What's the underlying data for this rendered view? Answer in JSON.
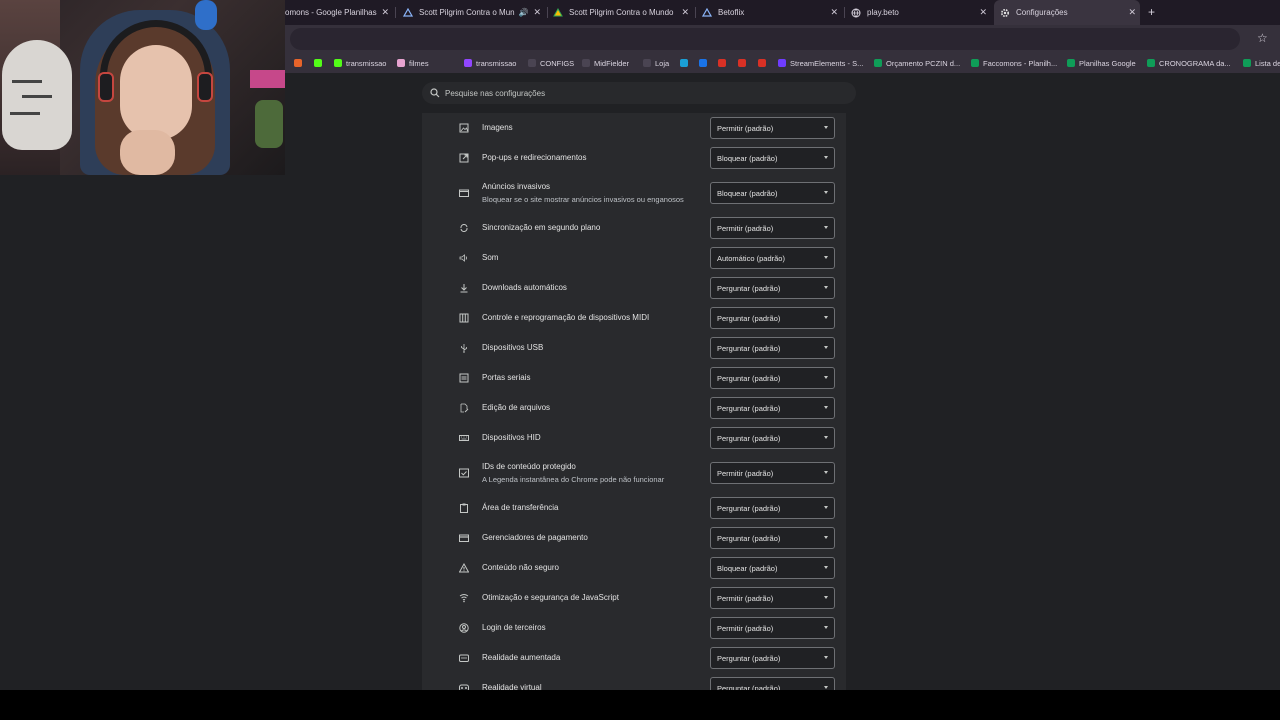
{
  "tabs": [
    {
      "label": "omons - Google Planilhas",
      "icon": "sheets-icon",
      "active": false
    },
    {
      "label": "Scott Pilgrim Contra o Mun",
      "icon": "drive-icon",
      "muted_icon": "speaker-icon",
      "active": false
    },
    {
      "label": "Scott Pilgrim Contra o Mundo",
      "icon": "drive-icon",
      "active": false
    },
    {
      "label": "Betoflix",
      "icon": "drive-icon",
      "active": false
    },
    {
      "label": "play.beto",
      "icon": "globe-icon",
      "active": false
    },
    {
      "label": "Configurações",
      "icon": "gear-icon",
      "active": true
    }
  ],
  "new_tab_label": "+",
  "bookmarks": [
    {
      "label": "",
      "color": "#e8642a"
    },
    {
      "label": "",
      "color": "#53fc18"
    },
    {
      "label": "transmissao",
      "color": "#53fc18"
    },
    {
      "label": "filmes",
      "color": "#e7a3d0"
    },
    {
      "label": "transmissao",
      "color": "#9146ff"
    },
    {
      "label": "CONFIGS",
      "color": "#4a4452"
    },
    {
      "label": "MidFielder",
      "color": "#4a4452"
    },
    {
      "label": "Loja",
      "color": "#4a4452"
    },
    {
      "label": "",
      "color": "#1a9fd6"
    },
    {
      "label": "",
      "color": "#1a73e8"
    },
    {
      "label": "",
      "color": "#d93025"
    },
    {
      "label": "",
      "color": "#d93025"
    },
    {
      "label": "",
      "color": "#d93025"
    },
    {
      "label": "StreamElements - S...",
      "color": "#6f3cff"
    },
    {
      "label": "Orçamento PCZIN d...",
      "color": "#0f9d58"
    },
    {
      "label": "Faccomons - Planilh...",
      "color": "#0f9d58"
    },
    {
      "label": "Planilhas Google",
      "color": "#0f9d58"
    },
    {
      "label": "CRONOGRAMA da...",
      "color": "#0f9d58"
    },
    {
      "label": "Lista de",
      "color": "#0f9d58"
    }
  ],
  "search": {
    "placeholder": "Pesquise nas configurações"
  },
  "settings": [
    {
      "label": "Imagens",
      "value": "Permitir (padrão)",
      "icon": "image-icon"
    },
    {
      "label": "Pop-ups e redirecionamentos",
      "value": "Bloquear (padrão)",
      "icon": "popup-icon"
    },
    {
      "label": "Anúncios invasivos",
      "sublabel": "Bloquear se o site mostrar anúncios invasivos ou enganosos",
      "value": "Bloquear (padrão)",
      "icon": "ads-icon"
    },
    {
      "label": "Sincronização em segundo plano",
      "value": "Permitir (padrão)",
      "icon": "sync-icon"
    },
    {
      "label": "Som",
      "value": "Automático (padrão)",
      "icon": "sound-icon"
    },
    {
      "label": "Downloads automáticos",
      "value": "Perguntar (padrão)",
      "icon": "download-icon"
    },
    {
      "label": "Controle e reprogramação de dispositivos MIDI",
      "value": "Perguntar (padrão)",
      "icon": "piano-icon"
    },
    {
      "label": "Dispositivos USB",
      "value": "Perguntar (padrão)",
      "icon": "usb-icon"
    },
    {
      "label": "Portas seriais",
      "value": "Perguntar (padrão)",
      "icon": "serial-port-icon"
    },
    {
      "label": "Edição de arquivos",
      "value": "Perguntar (padrão)",
      "icon": "file-edit-icon"
    },
    {
      "label": "Dispositivos HID",
      "value": "Perguntar (padrão)",
      "icon": "hid-icon"
    },
    {
      "label": "IDs de conteúdo protegido",
      "sublabel": "A Legenda instantânea do Chrome pode não funcionar",
      "value": "Permitir (padrão)",
      "icon": "protected-content-icon"
    },
    {
      "label": "Área de transferência",
      "value": "Perguntar (padrão)",
      "icon": "clipboard-icon"
    },
    {
      "label": "Gerenciadores de pagamento",
      "value": "Perguntar (padrão)",
      "icon": "credit-card-icon"
    },
    {
      "label": "Conteúdo não seguro",
      "value": "Bloquear (padrão)",
      "icon": "warning-icon"
    },
    {
      "label": "Otimização e segurança de JavaScript",
      "value": "Permitir (padrão)",
      "icon": "javascript-icon"
    },
    {
      "label": "Login de terceiros",
      "value": "Permitir (padrão)",
      "icon": "account-icon"
    },
    {
      "label": "Realidade aumentada",
      "value": "Perguntar (padrão)",
      "icon": "ar-icon"
    },
    {
      "label": "Realidade virtual",
      "value": "Perguntar (padrão)",
      "icon": "vr-icon"
    }
  ]
}
